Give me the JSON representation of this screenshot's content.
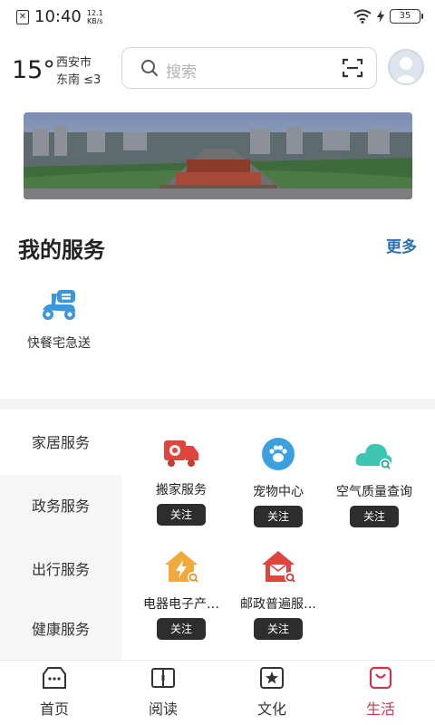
{
  "status_bar": {
    "time": "10:40",
    "speed_value": "12.1",
    "speed_unit": "KB/s",
    "battery": "35"
  },
  "header": {
    "temperature": "15°",
    "city": "西安市",
    "wind": "东南 ≤3",
    "search_placeholder": "搜索"
  },
  "my_services": {
    "title": "我的服务",
    "more_label": "更多",
    "items": [
      {
        "label": "快餐宅急送",
        "icon": "scooter-icon"
      }
    ]
  },
  "categories": [
    "家居服务",
    "政务服务",
    "出行服务",
    "健康服务"
  ],
  "active_category_index": 0,
  "services": [
    {
      "label": "搬家服务",
      "icon": "moving-truck-icon",
      "follow_label": "关注"
    },
    {
      "label": "宠物中心",
      "icon": "paw-icon",
      "follow_label": "关注"
    },
    {
      "label": "空气质量查询",
      "icon": "cloud-icon",
      "follow_label": "关注"
    },
    {
      "label": "电器电子产…",
      "icon": "house-lightning-icon",
      "follow_label": "关注"
    },
    {
      "label": "邮政普遍服…",
      "icon": "mail-house-icon",
      "follow_label": "关注"
    }
  ],
  "tabs": [
    {
      "label": "首页",
      "icon": "home-icon"
    },
    {
      "label": "阅读",
      "icon": "book-icon"
    },
    {
      "label": "文化",
      "icon": "star-icon"
    },
    {
      "label": "生活",
      "icon": "bag-icon",
      "active": true
    }
  ],
  "colors": {
    "accent": "#c8374d",
    "link": "#2a6fb3",
    "follow_button": "#2d2d2d"
  }
}
